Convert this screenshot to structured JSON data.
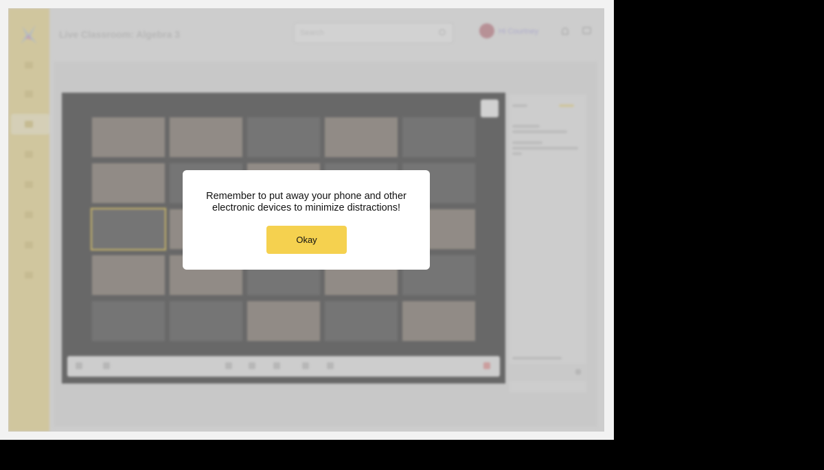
{
  "header": {
    "title": "Live Classroom: Algebra 3",
    "search_placeholder": "Search",
    "user_name": "Hi Courtney"
  },
  "modal": {
    "message": "Remember to put away your phone and other electronic devices to minimize distractions!",
    "button_label": "Okay"
  },
  "colors": {
    "accent_yellow": "#f5d14f",
    "sidebar": "#f1e0a0",
    "video_panel": "#4a4a4a"
  },
  "icons": [
    "logo-icon",
    "search-icon",
    "bell-icon",
    "chat-icon",
    "fullscreen-icon",
    "microphone-icon",
    "camera-icon",
    "send-icon"
  ]
}
